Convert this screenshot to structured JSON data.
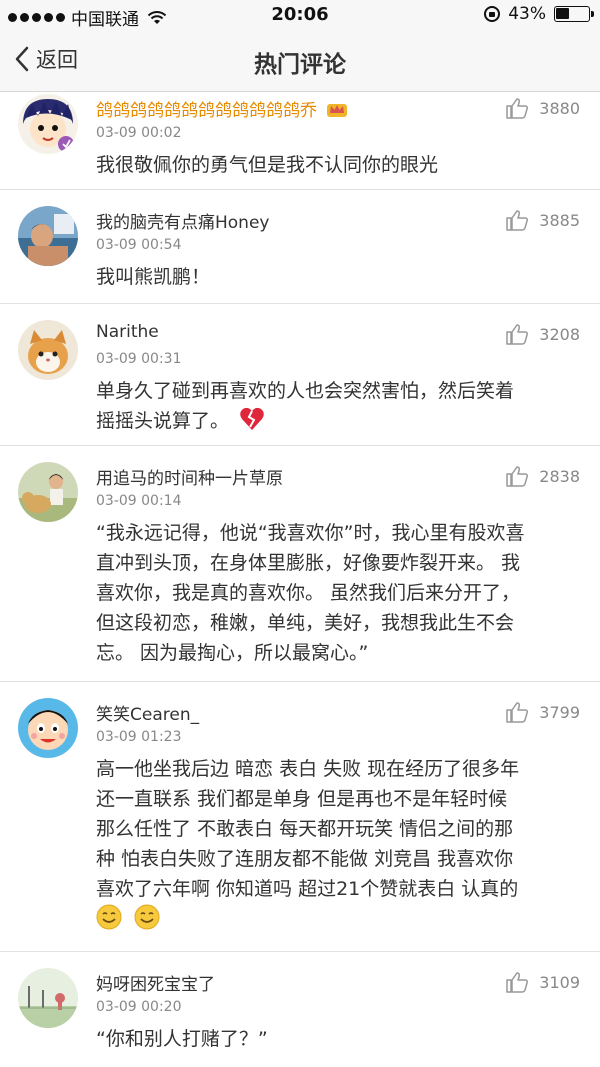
{
  "status": {
    "carrier": "中国联通",
    "time": "20:06",
    "battery_text": "43%",
    "battery_level": 0.43
  },
  "nav": {
    "back_label": "返回",
    "title": "热门评论"
  },
  "comments": [
    {
      "username": "鸽鸽鸽鸽鸽鸽鸽鸽鸽鸽鸽鸽乔",
      "time": "03-09 00:02",
      "likes": "3880",
      "lines": [
        "我很敬佩你的勇气但是我不认同你的眼光"
      ]
    },
    {
      "username": "我的脑壳有点痛Honey",
      "time": "03-09 00:54",
      "likes": "3885",
      "lines": [
        "我叫熊凯鹏！"
      ]
    },
    {
      "username": "Narithe",
      "time": "03-09 00:31",
      "likes": "3208",
      "lines": [
        "单身久了碰到再喜欢的人也会突然害怕，然后笑着",
        "摇摇头说算了。"
      ]
    },
    {
      "username": "用追马的时间种一片草原",
      "time": "03-09 00:14",
      "likes": "2838",
      "lines": [
        "“我永远记得，他说“我喜欢你”时，我心里有股欢喜",
        "直冲到头顶，在身体里膨胀，好像要炸裂开来。 我",
        "喜欢你，我是真的喜欢你。 虽然我们后来分开了，",
        "但这段初恋，稚嫩，单纯，美好，我想我此生不会",
        "忘。 因为最掏心，所以最窝心。”"
      ]
    },
    {
      "username": "笑笑Cearen_",
      "time": "03-09 01:23",
      "likes": "3799",
      "lines": [
        "高一他坐我后边 暗恋 表白 失败 现在经历了很多年",
        "还一直联系 我们都是单身 但是再也不是年轻时候",
        "那么任性了 不敢表白 每天都开玩笑 情侣之间的那",
        "种  怕表白失败了连朋友都不能做 刘竞昌 我喜欢你",
        "喜欢了六年啊 你知道吗 超过21个赞就表白 认真的"
      ]
    },
    {
      "username": "妈呀困死宝宝了",
      "time": "03-09 00:20",
      "likes": "3109",
      "lines": [
        "“你和别人打赌了？”"
      ]
    }
  ],
  "colors": {
    "gold_username": "#e68a00",
    "broken_heart": "#e0263b",
    "emoji_yellow": "#f7c93c"
  }
}
